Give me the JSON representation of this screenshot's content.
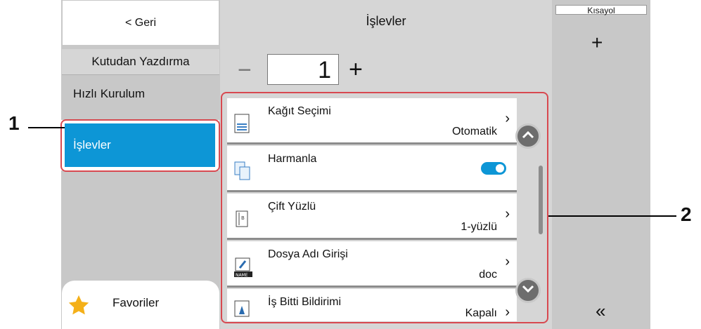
{
  "nav": {
    "back_label": "< Geri",
    "box_print_label": "Kutudan Yazdırma",
    "quick_setup_label": "Hızlı Kurulum",
    "functions_label": "İşlevler",
    "favorites_label": "Favoriler"
  },
  "main": {
    "title": "İşlevler",
    "quantity": "1",
    "minus_label": "−",
    "plus_label": "+"
  },
  "functions": [
    {
      "title": "Kağıt Seçimi",
      "value": "Otomatik",
      "icon": "paper-icon"
    },
    {
      "title": "Harmanla",
      "value": "",
      "icon": "collate-icon",
      "toggle_on": true
    },
    {
      "title": "Çift Yüzlü",
      "value": "1-yüzlü",
      "icon": "duplex-icon"
    },
    {
      "title": "Dosya Adı Girişi",
      "value": "doc",
      "icon": "file-name-icon"
    },
    {
      "title": "İş Bitti Bildirimi",
      "value": "Kapalı",
      "icon": "job-finish-icon"
    }
  ],
  "shortcut": {
    "label": "Kısayol",
    "add_label": "+",
    "collapse_label": "«"
  },
  "callouts": {
    "one": "1",
    "two": "2"
  },
  "colors": {
    "accent": "#0d96d6",
    "highlight": "#d84950",
    "scroll_button": "#6d6d6d"
  }
}
